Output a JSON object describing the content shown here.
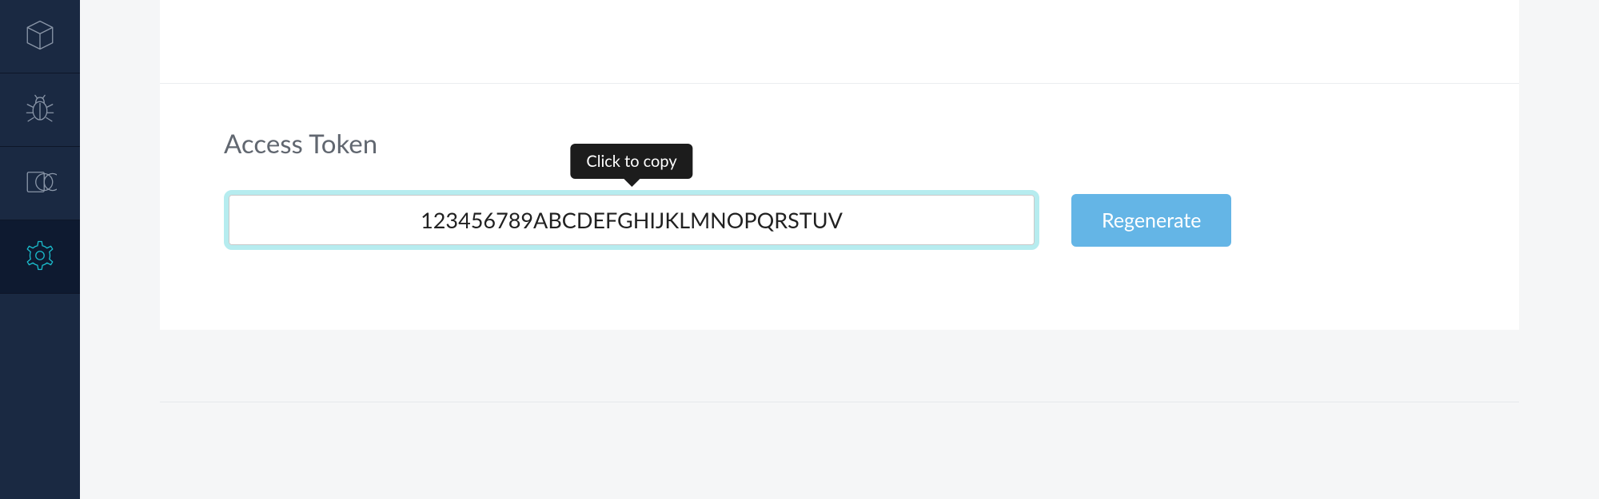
{
  "sidebar": {
    "items": [
      {
        "name": "box-icon"
      },
      {
        "name": "bug-icon"
      },
      {
        "name": "overlap-icon"
      },
      {
        "name": "gear-icon",
        "active": true
      }
    ]
  },
  "main": {
    "section_title": "Access Token",
    "token_value": "123456789ABCDEFGHIJKLMNOPQRSTUV",
    "tooltip_text": "Click to copy",
    "regenerate_label": "Regenerate"
  }
}
